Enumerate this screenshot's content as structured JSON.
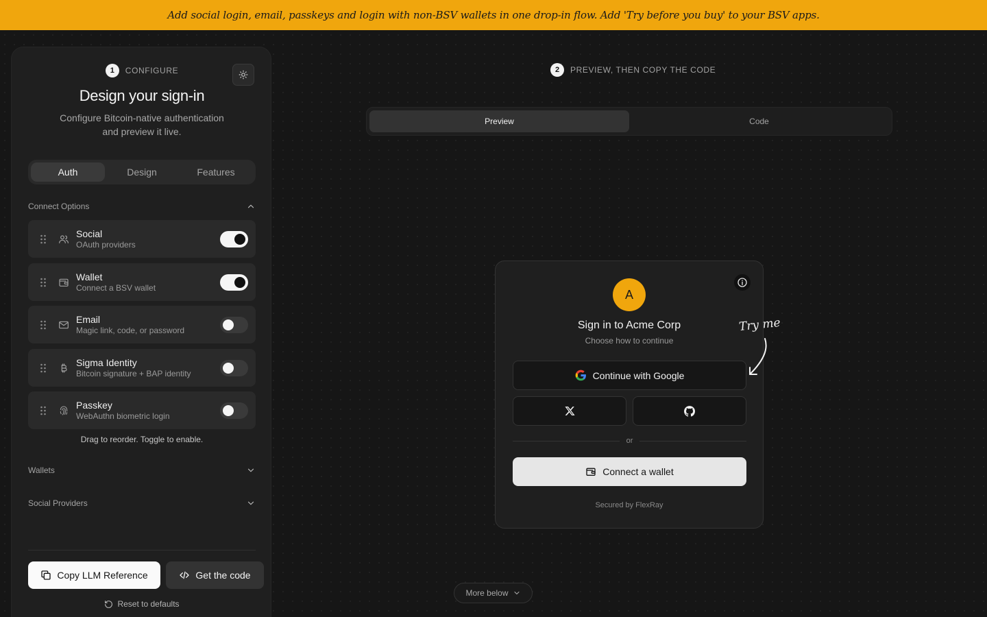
{
  "banner": {
    "text": "Add social login, email, passkeys and login with non-BSV wallets in one drop-in flow. Add 'Try before you buy' to your BSV apps."
  },
  "configure": {
    "step_num": "1",
    "step_label": "CONFIGURE",
    "title": "Design your sign-in",
    "subtitle": "Configure Bitcoin-native authentication and preview it live.",
    "tabs": [
      "Auth",
      "Design",
      "Features"
    ],
    "active_tab": "Auth",
    "connect_options_label": "Connect Options",
    "options": [
      {
        "title": "Social",
        "desc": "OAuth providers",
        "enabled": true,
        "icon": "users-icon"
      },
      {
        "title": "Wallet",
        "desc": "Connect a BSV wallet",
        "enabled": true,
        "icon": "wallet-icon"
      },
      {
        "title": "Email",
        "desc": "Magic link, code, or password",
        "enabled": false,
        "icon": "mail-icon"
      },
      {
        "title": "Sigma Identity",
        "desc": "Bitcoin signature + BAP identity",
        "enabled": false,
        "icon": "bitcoin-icon"
      },
      {
        "title": "Passkey",
        "desc": "WebAuthn biometric login",
        "enabled": false,
        "icon": "fingerprint-icon"
      }
    ],
    "hint": "Drag to reorder. Toggle to enable.",
    "wallets_label": "Wallets",
    "social_providers_label": "Social Providers",
    "copy_llm_label": "Copy LLM Reference",
    "get_code_label": "Get the code",
    "reset_label": "Reset to defaults"
  },
  "preview": {
    "step_num": "2",
    "step_label": "PREVIEW, THEN COPY THE CODE",
    "tabs": [
      "Preview",
      "Code"
    ],
    "active_tab": "Preview",
    "card": {
      "avatar_letter": "A",
      "title": "Sign in to Acme Corp",
      "subtitle": "Choose how to continue",
      "google_label": "Continue with Google",
      "or_label": "or",
      "wallet_label": "Connect a wallet",
      "secured_label": "Secured by FlexRay"
    },
    "try_me": "Try me",
    "more_below": "More below"
  },
  "colors": {
    "accent": "#f0a60d",
    "background": "#161616",
    "panel": "#1f1f1f"
  }
}
